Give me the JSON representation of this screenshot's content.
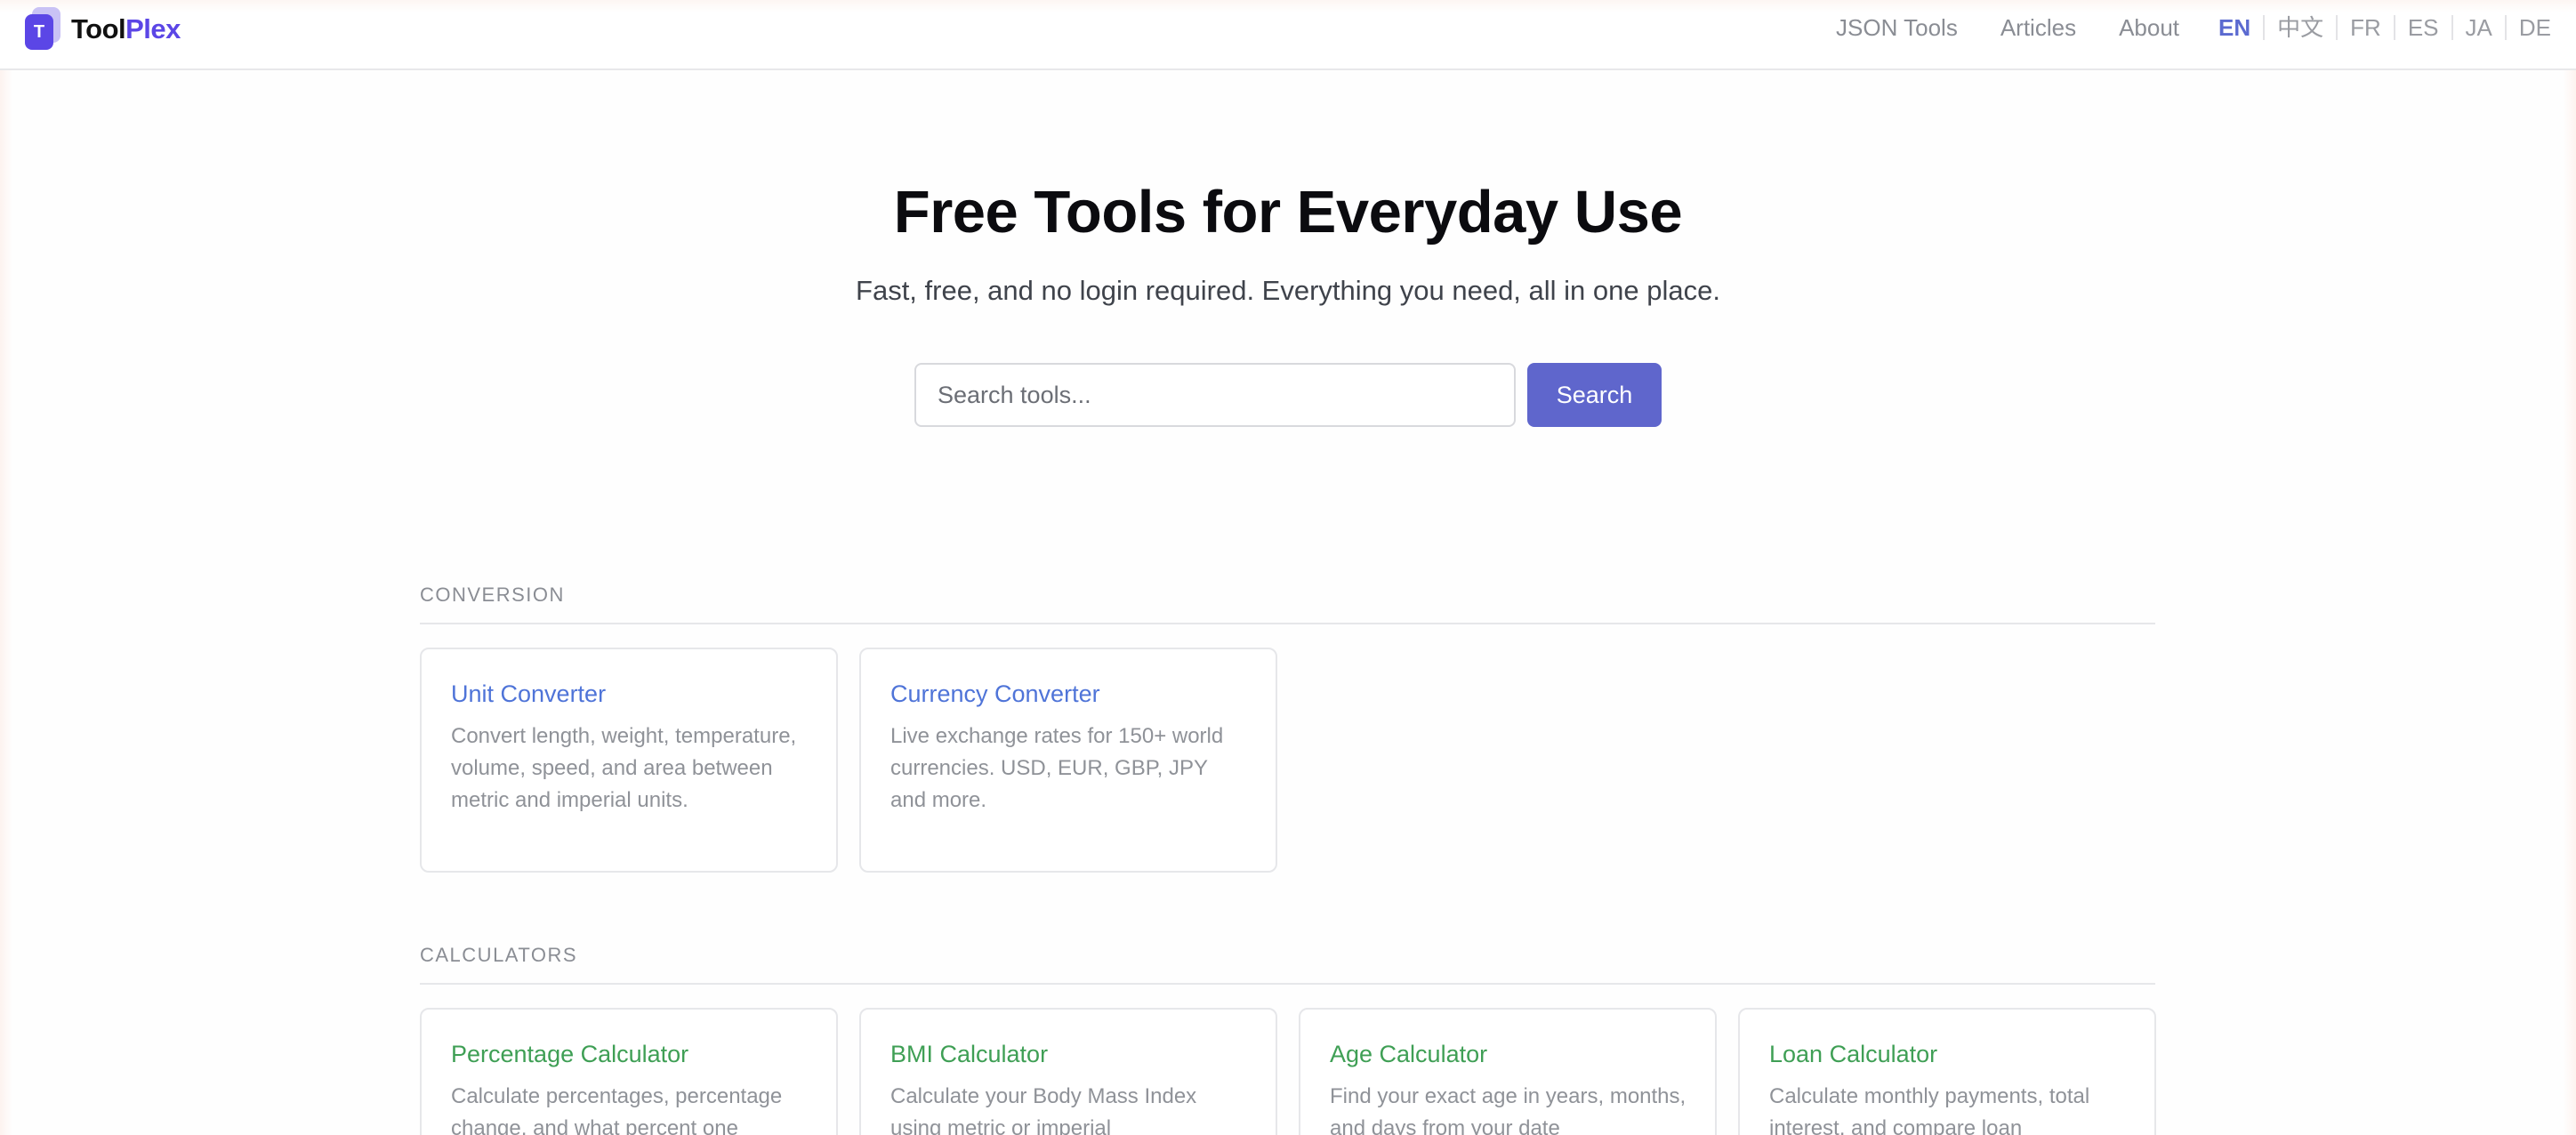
{
  "brand": {
    "logo_letter": "T",
    "name_part1": "Tool",
    "name_part2": "Plex",
    "accent": "#5b46e6"
  },
  "nav": {
    "links": [
      "JSON Tools",
      "Articles",
      "About"
    ],
    "languages": [
      "EN",
      "中文",
      "FR",
      "ES",
      "JA",
      "DE"
    ],
    "active_language": "EN"
  },
  "hero": {
    "title": "Free Tools for Everyday Use",
    "subtitle": "Fast, free, and no login required. Everything you need, all in one place.",
    "search_placeholder": "Search tools...",
    "search_button": "Search"
  },
  "sections": [
    {
      "title": "CONVERSION",
      "color": "#4f74d8",
      "cards": [
        {
          "title": "Unit Converter",
          "desc": "Convert length, weight, temperature, volume, speed, and area between metric and imperial units."
        },
        {
          "title": "Currency Converter",
          "desc": "Live exchange rates for 150+ world currencies. USD, EUR, GBP, JPY and more."
        }
      ]
    },
    {
      "title": "CALCULATORS",
      "color": "#3f9f55",
      "cards": [
        {
          "title": "Percentage Calculator",
          "desc": "Calculate percentages, percentage change, and what percent one"
        },
        {
          "title": "BMI Calculator",
          "desc": "Calculate your Body Mass Index using metric or imperial"
        },
        {
          "title": "Age Calculator",
          "desc": "Find your exact age in years, months, and days from your date"
        },
        {
          "title": "Loan Calculator",
          "desc": "Calculate monthly payments, total interest, and compare loan"
        }
      ]
    }
  ]
}
